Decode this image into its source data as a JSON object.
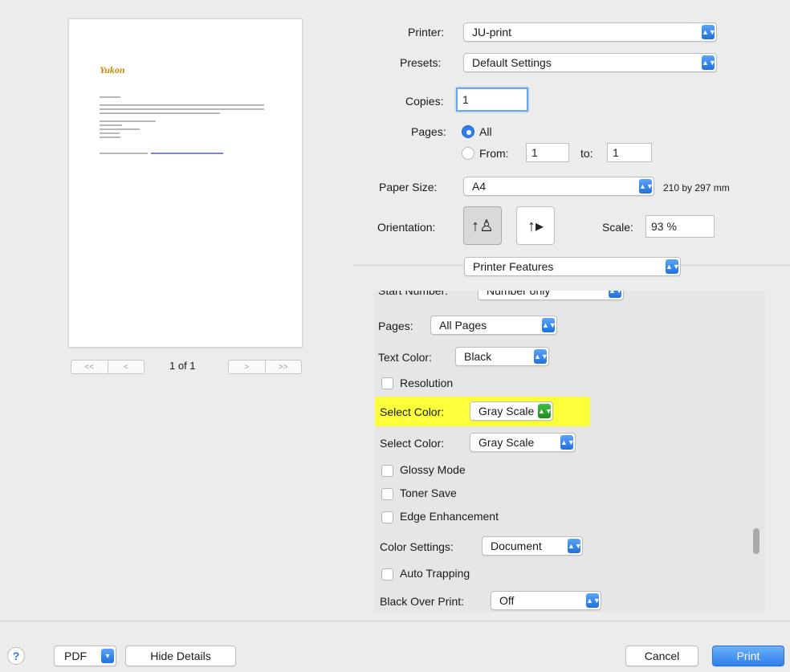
{
  "preview": {
    "logo": "Yukon",
    "page_indicator": "1 of 1",
    "first_label": "<<",
    "prev_label": "<",
    "next_label": ">",
    "last_label": ">>"
  },
  "printer": {
    "label": "Printer:",
    "value": "JU-print"
  },
  "presets": {
    "label": "Presets:",
    "value": "Default Settings"
  },
  "copies": {
    "label": "Copies:",
    "value": "1"
  },
  "pages": {
    "label": "Pages:",
    "all_label": "All",
    "from_label": "From:",
    "from_value": "1",
    "to_label": "to:",
    "to_value": "1"
  },
  "paper_size": {
    "label": "Paper Size:",
    "value": "A4",
    "dimensions": "210 by 297 mm"
  },
  "orientation": {
    "label": "Orientation:"
  },
  "scale": {
    "label": "Scale:",
    "value": "93 %"
  },
  "section": {
    "value": "Printer Features"
  },
  "features": {
    "start_number_label": "Start Number:",
    "start_number_value": "Number only",
    "pages_label": "Pages:",
    "pages_value": "All Pages",
    "text_color_label": "Text Color:",
    "text_color_value": "Black",
    "resolution_label": "Resolution",
    "select_color_1_label": "Select Color:",
    "select_color_1_value": "Gray Scale",
    "select_color_2_label": "Select Color:",
    "select_color_2_value": "Gray Scale",
    "glossy_label": "Glossy Mode",
    "toner_label": "Toner Save",
    "edge_label": "Edge Enhancement",
    "color_settings_label": "Color Settings:",
    "color_settings_value": "Document",
    "auto_trapping_label": "Auto Trapping",
    "black_over_print_label": "Black Over Print:",
    "black_over_print_value": "Off"
  },
  "footer": {
    "help": "?",
    "pdf": "PDF",
    "hide_details": "Hide Details",
    "cancel": "Cancel",
    "print": "Print"
  },
  "colors": {
    "accent": "#2f7de8",
    "highlight": "#fbff3a",
    "green_arrow": "#1e8f1e"
  }
}
